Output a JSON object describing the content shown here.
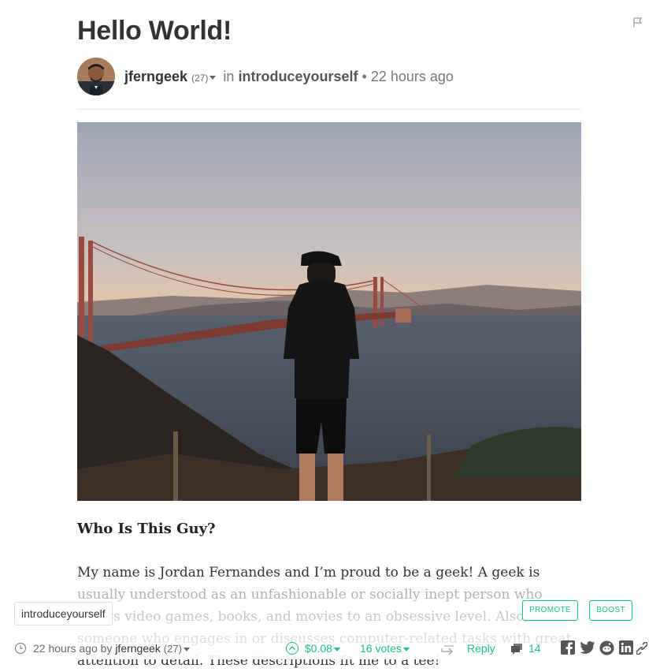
{
  "post": {
    "title": "Hello World!",
    "author": "jferngeek",
    "reputation": "(27)",
    "in_label": "in",
    "community": "introduceyourself",
    "separator": "•",
    "time": "22 hours ago"
  },
  "body": {
    "heading": "Who Is This Guy?",
    "paragraph": "My name is Jordan Fernandes and I’m proud to be a geek! A geek is usually understood as an unfashionable or socially inept person who enjoys video games, books, and movies to an obsessive level. Also, someone who engages in or discusses computer-related tasks with great attention to detail. These descriptions fit me to a tee!"
  },
  "bottom": {
    "tag": "introduceyourself",
    "promote_label": "PROMOTE",
    "boost_label": "BOOST"
  },
  "footer": {
    "time": "22 hours ago",
    "by_label": "by",
    "author": "jferngeek",
    "reputation": "(27)",
    "payout": "$0.08",
    "votes": "16 votes",
    "reply_label": "Reply",
    "comments": "14"
  },
  "icons": {
    "flag": "flag-icon",
    "clock": "clock-icon",
    "upvote": "upvote-icon",
    "reblog": "reblog-icon",
    "comments": "comments-icon",
    "facebook": "facebook-icon",
    "twitter": "twitter-icon",
    "reddit": "reddit-icon",
    "linkedin": "linkedin-icon",
    "link": "link-icon"
  },
  "colors": {
    "accent": "#1fbf8f",
    "text": "#333333",
    "muted": "#777777"
  }
}
